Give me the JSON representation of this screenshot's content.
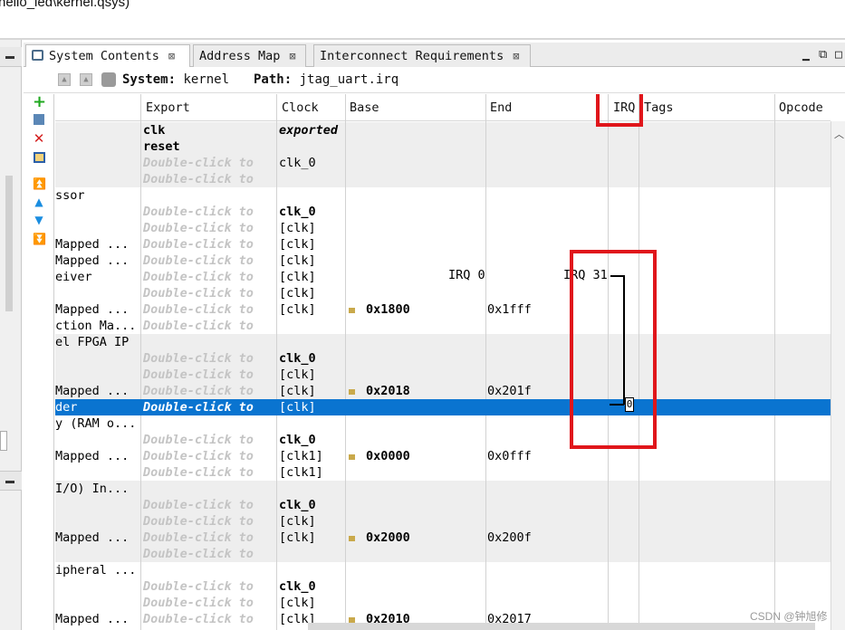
{
  "window": {
    "title": "hello_led\\kernel.qsys)"
  },
  "tabs": [
    {
      "label": "System Contents",
      "close": "⊠"
    },
    {
      "label": "Address Map",
      "close": "⊠"
    },
    {
      "label": "Interconnect Requirements",
      "close": "⊠"
    }
  ],
  "toolbar": {
    "system_label": "System:",
    "system_value": "kernel",
    "path_label": "Path:",
    "path_value": "jtag_uart.irq"
  },
  "columns": {
    "export": "Export",
    "clock": "Clock",
    "base": "Base",
    "end": "End",
    "irq": "IRQ",
    "tags": "Tags",
    "opcode": "Opcode"
  },
  "hint_text": "Double-click to",
  "irq_range": {
    "start": "IRQ 0",
    "end": "IRQ 31"
  },
  "irq_value": "0",
  "rows": [
    {
      "name": "",
      "export": "clk",
      "export_style": "bold",
      "clock": "exported",
      "clock_style": "bi",
      "base": "",
      "end": ""
    },
    {
      "name": "",
      "export": "reset",
      "export_style": "bold",
      "clock": "",
      "base": "",
      "end": ""
    },
    {
      "name": "",
      "export": "hint",
      "clock": "clk_0",
      "base": "",
      "end": ""
    },
    {
      "name": "",
      "export": "hint",
      "clock": "",
      "base": "",
      "end": ""
    },
    {
      "name": "ssor",
      "export": "",
      "clock": "",
      "base": "",
      "end": ""
    },
    {
      "name": "",
      "export": "hint",
      "clock": "clk_0",
      "clock_style": "bold",
      "base": "",
      "end": ""
    },
    {
      "name": "",
      "export": "hint",
      "clock": "[clk]",
      "base": "",
      "end": ""
    },
    {
      "name": "Mapped ...",
      "export": "hint",
      "clock": "[clk]",
      "base": "",
      "end": ""
    },
    {
      "name": "Mapped ...",
      "export": "hint",
      "clock": "[clk]",
      "base": "",
      "end": ""
    },
    {
      "name": "eiver",
      "export": "hint",
      "clock": "[clk]",
      "base": "",
      "end": ""
    },
    {
      "name": "",
      "export": "hint",
      "clock": "[clk]",
      "base": "",
      "end": ""
    },
    {
      "name": "Mapped ...",
      "export": "hint",
      "clock": "[clk]",
      "base": "0x1800",
      "end": "0x1fff"
    },
    {
      "name": "ction Ma...",
      "export": "hint",
      "clock": "",
      "base": "",
      "end": ""
    },
    {
      "name": "el FPGA IP",
      "export": "",
      "clock": "",
      "base": "",
      "end": ""
    },
    {
      "name": "",
      "export": "hint",
      "clock": "clk_0",
      "clock_style": "bold",
      "base": "",
      "end": ""
    },
    {
      "name": "",
      "export": "hint",
      "clock": "[clk]",
      "base": "",
      "end": ""
    },
    {
      "name": "Mapped ...",
      "export": "hint",
      "clock": "[clk]",
      "base": "0x2018",
      "end": "0x201f"
    },
    {
      "name": "der",
      "export": "hint",
      "clock": "[clk]",
      "base": "",
      "end": "",
      "selected": true
    },
    {
      "name": "y (RAM o...",
      "export": "",
      "clock": "",
      "base": "",
      "end": ""
    },
    {
      "name": "",
      "export": "hint",
      "clock": "clk_0",
      "clock_style": "bold",
      "base": "",
      "end": ""
    },
    {
      "name": "Mapped ...",
      "export": "hint",
      "clock": "[clk1]",
      "base": "0x0000",
      "end": "0x0fff"
    },
    {
      "name": "",
      "export": "hint",
      "clock": "[clk1]",
      "base": "",
      "end": ""
    },
    {
      "name": "I/O) In...",
      "export": "",
      "clock": "",
      "base": "",
      "end": ""
    },
    {
      "name": "",
      "export": "hint",
      "clock": "clk_0",
      "clock_style": "bold",
      "base": "",
      "end": ""
    },
    {
      "name": "",
      "export": "hint",
      "clock": "[clk]",
      "base": "",
      "end": ""
    },
    {
      "name": "Mapped ...",
      "export": "hint",
      "clock": "[clk]",
      "base": "0x2000",
      "end": "0x200f"
    },
    {
      "name": "",
      "export": "hint",
      "clock": "",
      "base": "",
      "end": ""
    },
    {
      "name": "ipheral ...",
      "export": "",
      "clock": "",
      "base": "",
      "end": ""
    },
    {
      "name": "",
      "export": "hint",
      "clock": "clk_0",
      "clock_style": "bold",
      "base": "",
      "end": ""
    },
    {
      "name": "",
      "export": "hint",
      "clock": "[clk]",
      "base": "",
      "end": ""
    },
    {
      "name": "Mapped ...",
      "export": "hint",
      "clock": "[clk]",
      "base": "0x2010",
      "end": "0x2017"
    }
  ],
  "watermark": "CSDN @钟旭修",
  "colors": {
    "selection": "#0a74d0",
    "annotation": "#e0161b",
    "group_bg": "#eeeeee"
  }
}
